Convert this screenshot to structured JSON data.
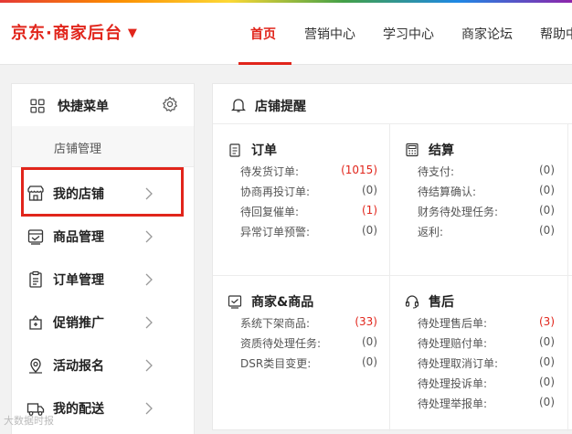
{
  "header": {
    "logo": "京东·商家后台",
    "logo_caret": "▼",
    "nav": [
      "首页",
      "营销中心",
      "学习中心",
      "商家论坛",
      "帮助中"
    ]
  },
  "sidebar": {
    "quick_title": "快捷菜单",
    "quick_sub": "店铺管理",
    "items": [
      {
        "label": "我的店铺",
        "icon": "store-icon"
      },
      {
        "label": "商品管理",
        "icon": "product-icon"
      },
      {
        "label": "订单管理",
        "icon": "order-icon"
      },
      {
        "label": "促销推广",
        "icon": "promotion-icon"
      },
      {
        "label": "活动报名",
        "icon": "activity-icon"
      },
      {
        "label": "我的配送",
        "icon": "delivery-icon"
      }
    ]
  },
  "panel": {
    "title": "店铺提醒",
    "sections": [
      {
        "title": "订单",
        "rows": [
          {
            "k": "待发货订单:",
            "v": "(1015)",
            "red": true
          },
          {
            "k": "协商再投订单:",
            "v": "(0)",
            "red": false
          },
          {
            "k": "待回复催单:",
            "v": "(1)",
            "red": true
          },
          {
            "k": "异常订单预警:",
            "v": "(0)",
            "red": false
          }
        ]
      },
      {
        "title": "结算",
        "rows": [
          {
            "k": "待支付:",
            "v": "(0)",
            "red": false
          },
          {
            "k": "待结算确认:",
            "v": "(0)",
            "red": false
          },
          {
            "k": "财务待处理任务:",
            "v": "(0)",
            "red": false
          },
          {
            "k": "返利:",
            "v": "(0)",
            "red": false
          }
        ]
      },
      {
        "title": "商家&商品",
        "rows": [
          {
            "k": "系统下架商品:",
            "v": "(33)",
            "red": true
          },
          {
            "k": "资质待处理任务:",
            "v": "(0)",
            "red": false
          },
          {
            "k": "DSR类目变更:",
            "v": "(0)",
            "red": false
          }
        ]
      },
      {
        "title": "售后",
        "rows": [
          {
            "k": "待处理售后单:",
            "v": "(3)",
            "red": true
          },
          {
            "k": "待处理赔付单:",
            "v": "(0)",
            "red": false
          },
          {
            "k": "待处理取消订单:",
            "v": "(0)",
            "red": false
          },
          {
            "k": "待处理投诉单:",
            "v": "(0)",
            "red": false
          },
          {
            "k": "待处理举报单:",
            "v": "(0)",
            "red": false
          }
        ]
      }
    ]
  },
  "watermark": "大数据时报",
  "colors": {
    "accent": "#e1251b"
  }
}
